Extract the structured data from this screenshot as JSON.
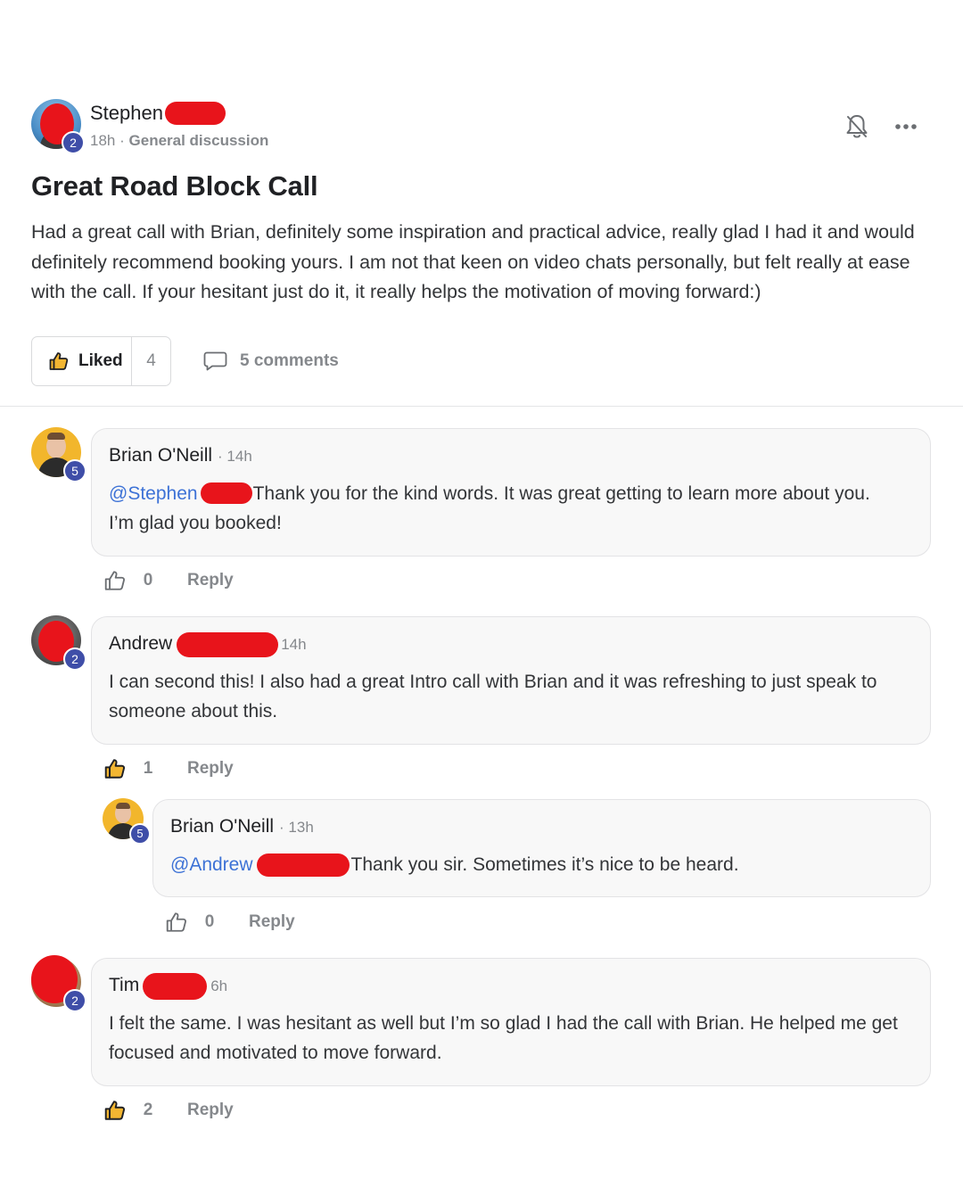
{
  "post": {
    "author": "Stephen",
    "author_level": "2",
    "time": "18h",
    "separator": "·",
    "category": "General discussion",
    "title": "Great Road Block Call",
    "body": "Had a great call with Brian, definitely some inspiration and practical advice, really glad I had it and would definitely recommend booking yours. I am not that keen on video chats personally, but felt really at ease with the call. If your hesitant just do it, it really helps the motivation of moving forward:)",
    "like_label": "Liked",
    "like_count": "4",
    "comments_label": "5 comments",
    "notification_icon": "bell-off-icon",
    "menu_icon": "more-dots-icon"
  },
  "comments": [
    {
      "author": "Brian O'Neill",
      "level": "5",
      "time": "· 14h",
      "mention": "@Stephen",
      "text_after_mention": "Thank you for the kind words. It was great getting to learn more about you.",
      "text_line2": "I’m glad you booked!",
      "likes": "0",
      "reply_label": "Reply"
    },
    {
      "author": "Andrew",
      "level": "2",
      "time": "14h",
      "text": "I can second this! I also had a great Intro call with Brian and it was refreshing to just speak to someone about this.",
      "likes": "1",
      "reply_label": "Reply"
    },
    {
      "author": "Brian O'Neill",
      "level": "5",
      "time": "· 13h",
      "mention": "@Andrew",
      "text_after_mention": "Thank you sir. Sometimes it’s nice to be heard.",
      "likes": "0",
      "reply_label": "Reply"
    },
    {
      "author": "Tim",
      "level": "2",
      "time": "6h",
      "text": "I felt the same. I was hesitant as well but I’m so glad I had the call with Brian. He helped me get focused and motivated to move forward.",
      "likes": "2",
      "reply_label": "Reply"
    }
  ],
  "colors": {
    "mention": "#3d72d6",
    "level_badge": "#3f4ea8",
    "redaction": "#e8141b",
    "muted_text": "#85888c",
    "bubble_bg": "#f8f8f8"
  }
}
